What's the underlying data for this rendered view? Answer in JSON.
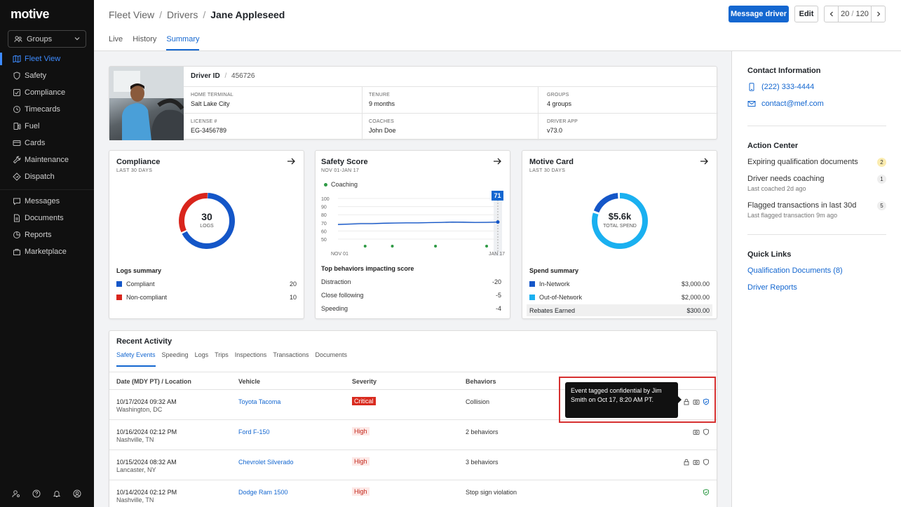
{
  "app": {
    "logo": "motive"
  },
  "sidebar": {
    "groups_label": "Groups",
    "items": [
      {
        "label": "Fleet View",
        "icon": "map-icon",
        "active": true
      },
      {
        "label": "Safety",
        "icon": "shield-icon"
      },
      {
        "label": "Compliance",
        "icon": "compliance-icon"
      },
      {
        "label": "Timecards",
        "icon": "clock-icon"
      },
      {
        "label": "Fuel",
        "icon": "fuel-icon"
      },
      {
        "label": "Cards",
        "icon": "card-icon"
      },
      {
        "label": "Maintenance",
        "icon": "wrench-icon"
      },
      {
        "label": "Dispatch",
        "icon": "dispatch-icon"
      },
      {
        "label": "Messages",
        "icon": "message-icon"
      },
      {
        "label": "Documents",
        "icon": "document-icon"
      },
      {
        "label": "Reports",
        "icon": "reports-icon"
      },
      {
        "label": "Marketplace",
        "icon": "marketplace-icon"
      }
    ]
  },
  "header": {
    "breadcrumb": [
      "Fleet View",
      "Drivers",
      "Jane Appleseed"
    ],
    "tabs": [
      "Live",
      "History",
      "Summary"
    ],
    "message_btn": "Message driver",
    "edit_btn": "Edit",
    "pager_current": "20",
    "pager_sep": "/",
    "pager_total": "120"
  },
  "driver": {
    "id_label": "Driver ID",
    "id_sep": "/",
    "id_value": "456726",
    "fields": [
      {
        "label": "HOME TERMINAL",
        "value": "Salt Lake City"
      },
      {
        "label": "TENURE",
        "value": "9 months"
      },
      {
        "label": "GROUPS",
        "value": "4 groups"
      },
      {
        "label": "LICENSE #",
        "value": "EG-3456789"
      },
      {
        "label": "COACHES",
        "value": "John Doe"
      },
      {
        "label": "DRIVER APP",
        "value": "v73.0"
      }
    ]
  },
  "compliance": {
    "title": "Compliance",
    "subtitle": "LAST 30 DAYS",
    "center_value": "30",
    "center_label": "LOGS",
    "summary_title": "Logs summary",
    "legend": [
      {
        "label": "Compliant",
        "value": "20",
        "color": "#1456c8"
      },
      {
        "label": "Non-compliant",
        "value": "10",
        "color": "#d9251c"
      }
    ]
  },
  "safety": {
    "title": "Safety Score",
    "subtitle": "NOV 01-JAN 17",
    "legend": "Coaching",
    "current": "71",
    "behaviors_title": "Top behaviors impacting score",
    "behaviors": [
      {
        "label": "Distraction",
        "value": "-20"
      },
      {
        "label": "Close following",
        "value": "-5"
      },
      {
        "label": "Speeding",
        "value": "-4"
      }
    ],
    "chart_data": {
      "type": "line",
      "x_labels": [
        "NOV 01",
        "JAN 17"
      ],
      "y_ticks": [
        "100",
        "90",
        "80",
        "70",
        "60",
        "50"
      ],
      "ylim": [
        50,
        100
      ],
      "series": [
        {
          "values": [
            68,
            68.5,
            69,
            69,
            69.5,
            69.8,
            70,
            70,
            70.3,
            70.5,
            71,
            70.8,
            70.5,
            70.6,
            71
          ]
        }
      ],
      "coaching_markers": [
        0.17,
        0.34,
        0.61,
        0.93
      ]
    }
  },
  "motive_card": {
    "title": "Motive Card",
    "subtitle": "LAST 30 DAYS",
    "center_value": "$5.6k",
    "center_label": "TOTAL SPEND",
    "summary_title": "Spend summary",
    "legend": [
      {
        "label": "In-Network",
        "value": "$3,000.00",
        "color": "#1456c8"
      },
      {
        "label": "Out-of-Network",
        "value": "$2,000.00",
        "color": "#1ab0f0"
      }
    ],
    "rebates_label": "Rebates Earned",
    "rebates_value": "$300.00"
  },
  "recent": {
    "title": "Recent Activity",
    "tabs": [
      "Safety Events",
      "Speeding",
      "Logs",
      "Trips",
      "Inspections",
      "Transactions",
      "Documents"
    ],
    "columns": [
      "Date (MDY PT) / Location",
      "Vehicle",
      "Severity",
      "Behaviors"
    ],
    "rows": [
      {
        "date": "10/17/2024 09:32 AM",
        "location": "Washington, DC",
        "vehicle": "Toyota Tacoma",
        "severity": "Critical",
        "behaviors": "Collision"
      },
      {
        "date": "10/16/2024 02:12 PM",
        "location": "Nashville, TN",
        "vehicle": "Ford F-150",
        "severity": "High",
        "behaviors": "2 behaviors"
      },
      {
        "date": "10/15/2024 08:32 AM",
        "location": "Lancaster, NY",
        "vehicle": "Chevrolet Silverado",
        "severity": "High",
        "behaviors": "3 behaviors"
      },
      {
        "date": "10/14/2024 02:12 PM",
        "location": "Nashville, TN",
        "vehicle": "Dodge Ram 1500",
        "severity": "High",
        "behaviors": "Stop sign violation"
      }
    ],
    "tooltip": "Event tagged confidential by Jim Smith on Oct 17, 8:20 AM PT."
  },
  "right_panel": {
    "contact_title": "Contact Information",
    "phone": "(222) 333-4444",
    "email": "contact@mef.com",
    "action_title": "Action Center",
    "actions": [
      {
        "title": "Expiring qualification documents",
        "sub": "",
        "count": "2"
      },
      {
        "title": "Driver needs coaching",
        "sub": "Last coached 2d ago",
        "count": "1"
      },
      {
        "title": "Flagged transactions in last 30d",
        "sub": "Last flagged transaction 9m ago",
        "count": "5"
      }
    ],
    "links_title": "Quick Links",
    "links": [
      "Qualification Documents (8)",
      "Driver Reports"
    ]
  }
}
